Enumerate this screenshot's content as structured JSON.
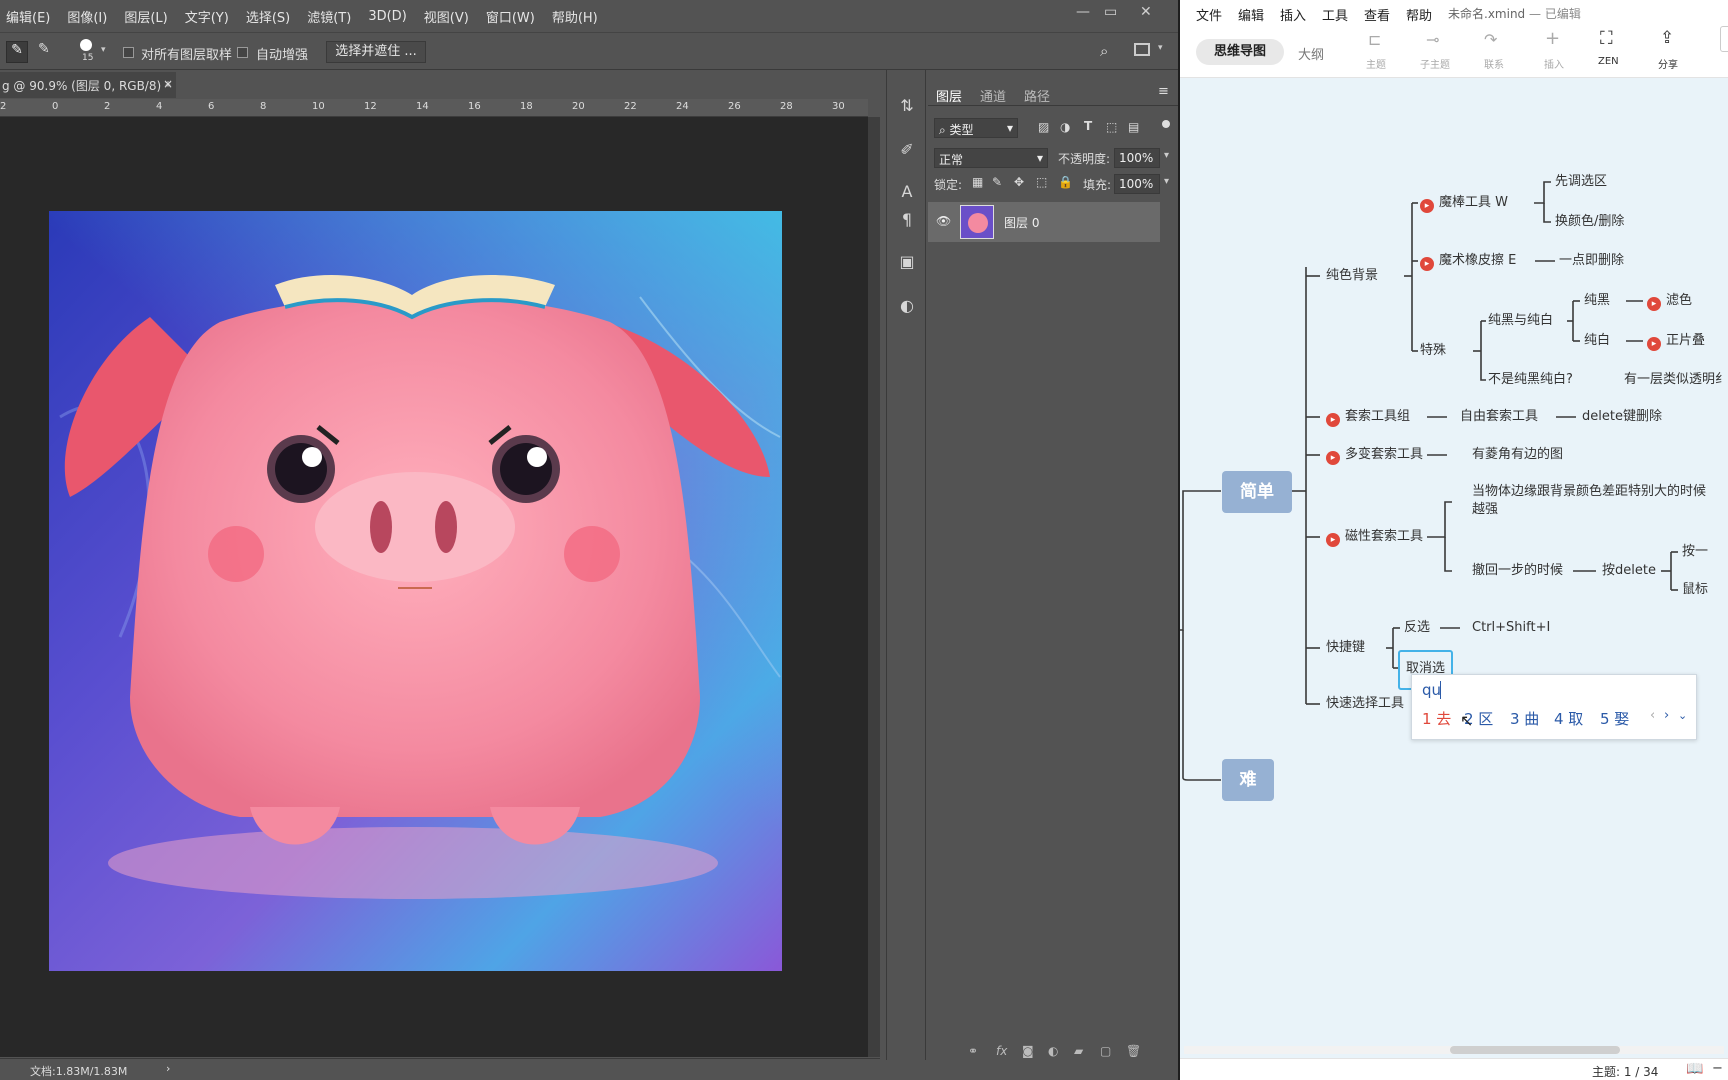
{
  "ps": {
    "menu": [
      "编辑(E)",
      "图像(I)",
      "图层(L)",
      "文字(Y)",
      "选择(S)",
      "滤镜(T)",
      "3D(D)",
      "视图(V)",
      "窗口(W)",
      "帮助(H)"
    ],
    "options": {
      "brush_size": "15",
      "sample_all_layers": "对所有图层取样",
      "auto_enhance": "自动增强",
      "select_mask_button": "选择并遮住 ..."
    },
    "doc_tab": "g @ 90.9% (图层 0, RGB/8) *",
    "ruler_ticks": [
      "2",
      "0",
      "2",
      "4",
      "6",
      "8",
      "10",
      "12",
      "14",
      "16",
      "18",
      "20",
      "22",
      "24",
      "26",
      "28",
      "30"
    ],
    "status": "文档:1.83M/1.83M",
    "panel": {
      "tabs": [
        "图层",
        "通道",
        "路径"
      ],
      "filter_kind": "类型",
      "blend_mode": "正常",
      "opacity_label": "不透明度:",
      "opacity_value": "100%",
      "lock_label": "锁定:",
      "fill_label": "填充:",
      "fill_value": "100%",
      "layer_name": "图层 0"
    },
    "colors": {
      "bg": "#535353",
      "canvas": "#282828",
      "pig": "#f28ea0"
    }
  },
  "xmind": {
    "menu": [
      "文件",
      "编辑",
      "插入",
      "工具",
      "查看",
      "帮助"
    ],
    "title": "未命名.xmind",
    "title_state": "— 已编辑",
    "view_tabs": [
      "思维导图",
      "大纲"
    ],
    "tools": [
      "主题",
      "子主题",
      "联系",
      "插入",
      "ZEN",
      "分享"
    ],
    "nodes": {
      "root1": "简单",
      "root2": "难",
      "solid_bg": "纯色背景",
      "magic_wand": "魔棒工具",
      "magic_wand_key": "W",
      "first_select": "先调选区",
      "change_color": "换颜色/删除",
      "magic_eraser": "魔术橡皮擦",
      "magic_eraser_key": "E",
      "one_click_delete": "一点即删除",
      "special": "特殊",
      "pure_bw": "纯黑与纯白",
      "pure_black": "纯黑",
      "filter": "滤色",
      "pure_white": "纯白",
      "multiply": "正片叠",
      "not_pure": "不是纯黑纯白?",
      "transparent": "有一层类似透明纟",
      "lasso_group": "套索工具组",
      "free_lasso": "自由套索工具",
      "delete_key": "delete键删除",
      "poly_lasso": "多变套索工具",
      "poly_desc": "有菱角有边的图",
      "magnetic_lasso": "磁性套索工具",
      "magnetic_desc_1": "当物体边缘跟背景颜色差距特别大的时候",
      "magnetic_desc_2": "越强",
      "undo_step": "撤回一步的时候",
      "press_delete": "按delete",
      "press_one": "按一",
      "mouse": "鼠标",
      "shortcuts": "快捷键",
      "invert": "反选",
      "invert_key": "Ctrl+Shift+I",
      "deselect": "取消选",
      "quick_select": "快速选择工具"
    },
    "ime": {
      "input": "qu",
      "candidates": [
        "1 去",
        "2 区",
        "3 曲",
        "4 取",
        "5 娶"
      ]
    },
    "status": "主题: 1 / 34"
  }
}
